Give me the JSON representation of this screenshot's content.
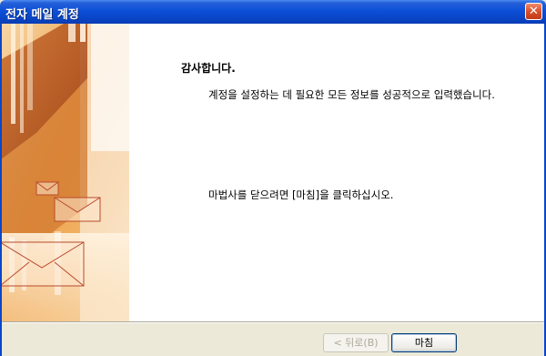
{
  "window": {
    "title": "전자 메일 계정",
    "close_glyph": "✕"
  },
  "content": {
    "heading": "감사합니다.",
    "message": "계정을 설정하는 데 필요한 모든 정보를 성공적으로 입력했습니다.",
    "finish_instruction": "마법사를 닫으려면 [마침]을 클릭하십시오."
  },
  "buttons": {
    "back_label": "< 뒤로(B)",
    "finish_label": "마침",
    "back_enabled": false
  },
  "colors": {
    "titlebar": "#0a46c8",
    "art_primary": "#e8902c",
    "art_dark": "#b4501c",
    "envelope": "#b94a2c"
  },
  "icons": {
    "close": "close-icon",
    "art": "envelope-wizard-art"
  }
}
